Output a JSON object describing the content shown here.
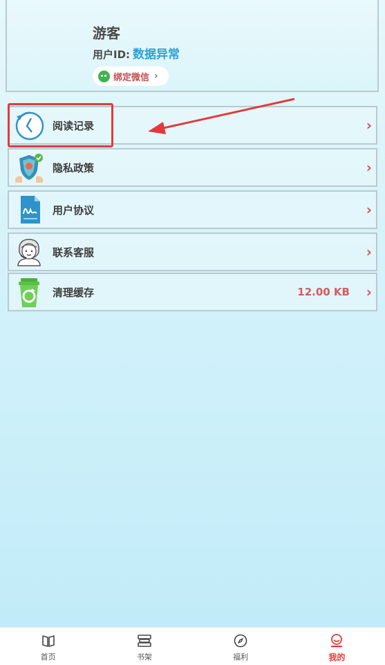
{
  "profile": {
    "name": "游客",
    "user_id_label": "用户ID:",
    "user_id_value": "数据异常",
    "bind_wechat_label": "绑定微信",
    "bind_wechat_arrow": "›"
  },
  "menu": [
    {
      "label": "阅读记录",
      "icon": "clock-history-icon",
      "value": ""
    },
    {
      "label": "隐私政策",
      "icon": "shield-privacy-icon",
      "value": ""
    },
    {
      "label": "用户协议",
      "icon": "signature-document-icon",
      "value": ""
    },
    {
      "label": "联系客服",
      "icon": "customer-service-icon",
      "value": ""
    },
    {
      "label": "清理缓存",
      "icon": "recycle-bin-icon",
      "value": "12.00 KB"
    }
  ],
  "menu_arrow": "›",
  "tabbar": {
    "items": [
      {
        "label": "首页",
        "icon": "book-open-icon",
        "active": false
      },
      {
        "label": "书架",
        "icon": "bookshelf-icon",
        "active": false
      },
      {
        "label": "福利",
        "icon": "compass-icon",
        "active": false
      },
      {
        "label": "我的",
        "icon": "user-face-icon",
        "active": true
      }
    ]
  },
  "colors": {
    "accent_red": "#e23a3a",
    "id_blue": "#27a3d8",
    "wechat_green": "#3fb34f"
  }
}
